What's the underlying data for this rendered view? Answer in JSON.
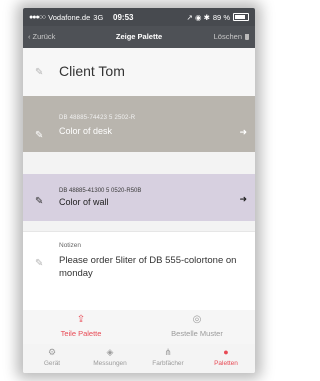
{
  "statusbar": {
    "signal": "●●●○○",
    "carrier": "Vodafone.de",
    "network": "3G",
    "time": "09:53",
    "icons": "↗ ◉ ✱",
    "battery_percent": "89 %"
  },
  "navbar": {
    "back_label": "Zurück",
    "title": "Zeige Palette",
    "delete_label": "Löschen"
  },
  "client": {
    "name": "Client Tom"
  },
  "colors": [
    {
      "code": "DB 48885-74423 5 2502-R",
      "description": "Color of desk",
      "swatch": "#b9b5ae"
    },
    {
      "code": "DB 48885-41300 5 0520-R50B",
      "description": "Color of wall",
      "swatch": "#d7d0e0"
    }
  ],
  "notes": {
    "label": "Notizen",
    "text": "Please order 5liter of DB 555-colortone on monday"
  },
  "actions": {
    "share_label": "Teile Palette",
    "order_label": "Bestelle Muster"
  },
  "tabs": [
    {
      "label": "Gerät",
      "icon": "gear-icon",
      "active": false
    },
    {
      "label": "Messungen",
      "icon": "layers-icon",
      "active": false
    },
    {
      "label": "Farbfächer",
      "icon": "fan-icon",
      "active": false
    },
    {
      "label": "Paletten",
      "icon": "palette-icon",
      "active": true
    }
  ],
  "accent_color": "#e84a55"
}
